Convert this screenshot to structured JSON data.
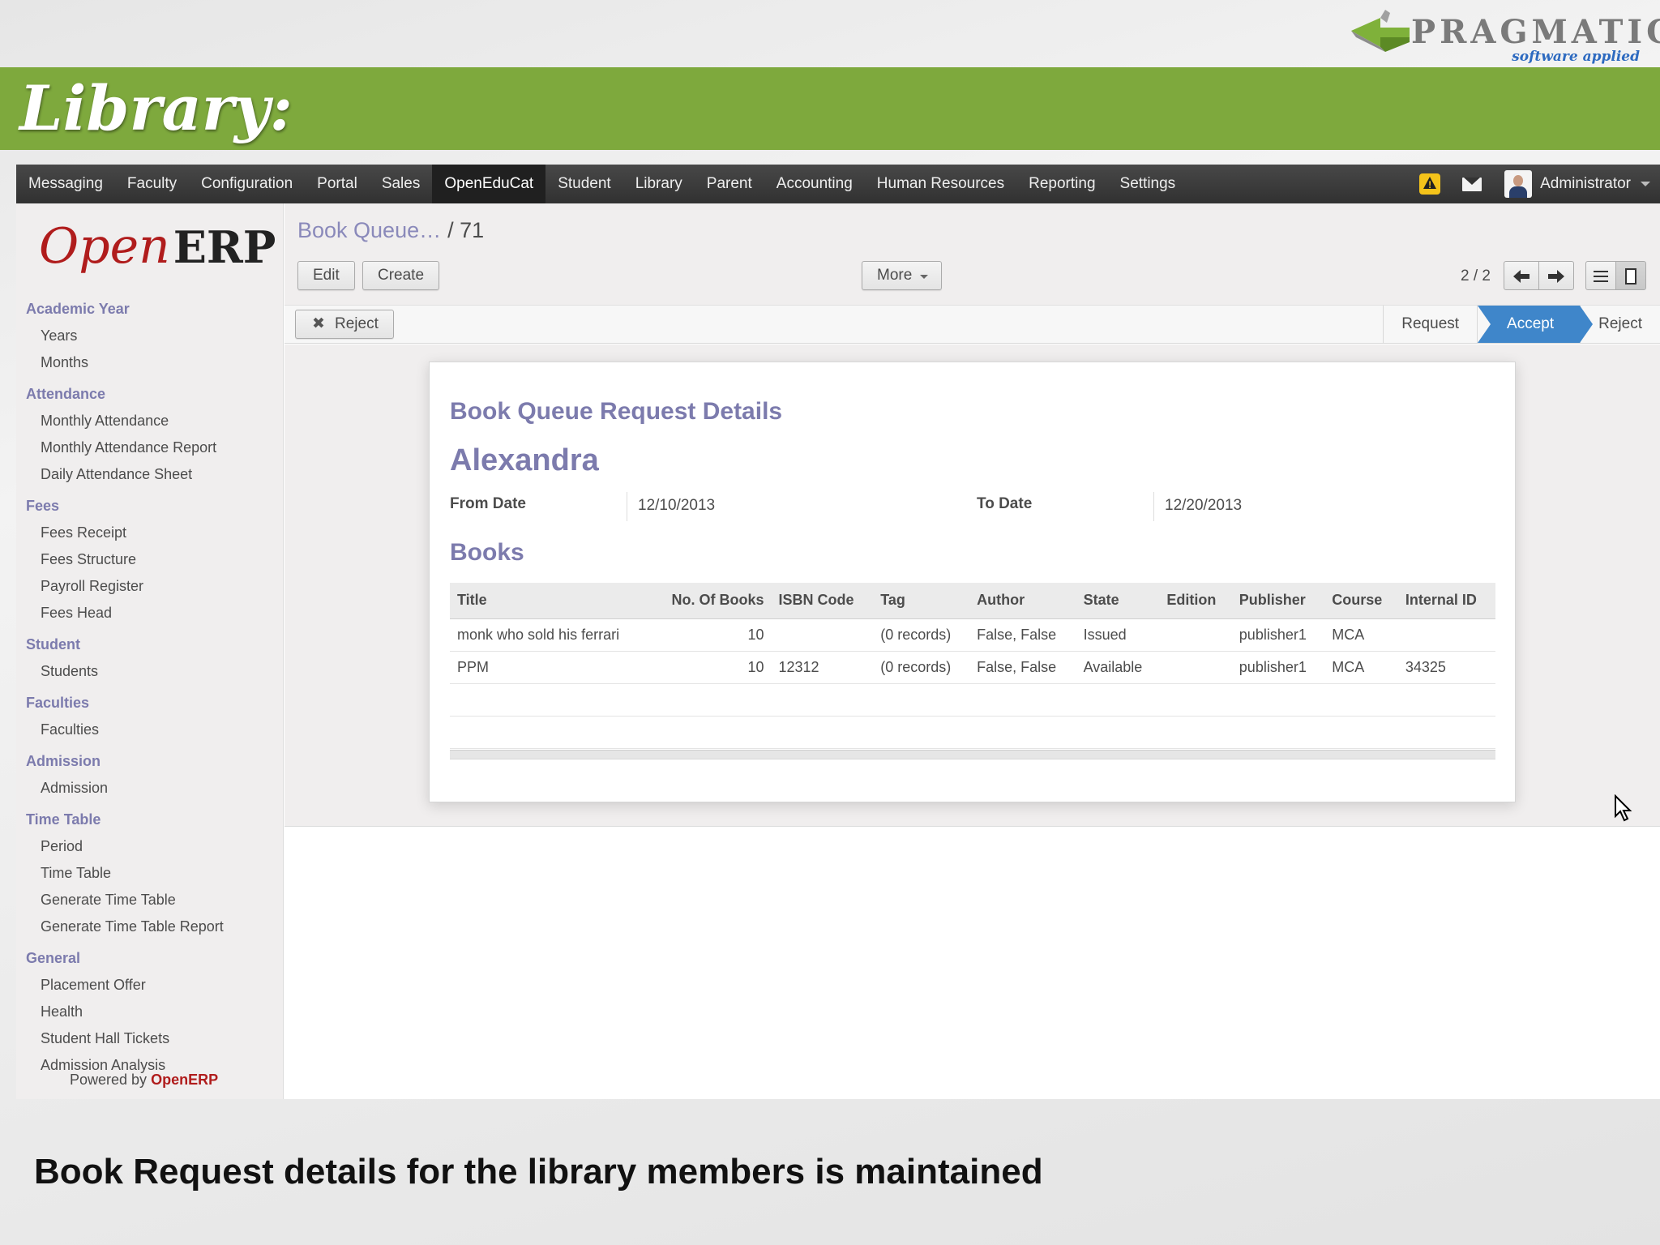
{
  "brand": {
    "word": "PRAGMATIC",
    "tagline": "software applied"
  },
  "slide": {
    "title": "Library:",
    "caption": "Book Request details for the library members is maintained"
  },
  "topbar": {
    "menu": [
      "Messaging",
      "Faculty",
      "Configuration",
      "Portal",
      "Sales",
      "OpenEduCat",
      "Student",
      "Library",
      "Parent",
      "Accounting",
      "Human Resources",
      "Reporting",
      "Settings"
    ],
    "active": "OpenEduCat",
    "user": "Administrator"
  },
  "sidebar": {
    "logo_open": "Open",
    "logo_erp": "ERP",
    "sections": [
      {
        "title": "Academic Year",
        "items": [
          "Years",
          "Months"
        ]
      },
      {
        "title": "Attendance",
        "items": [
          "Monthly Attendance",
          "Monthly Attendance Report",
          "Daily Attendance Sheet"
        ]
      },
      {
        "title": "Fees",
        "items": [
          "Fees Receipt",
          "Fees Structure",
          "Payroll Register",
          "Fees Head"
        ]
      },
      {
        "title": "Student",
        "items": [
          "Students"
        ]
      },
      {
        "title": "Faculties",
        "items": [
          "Faculties"
        ]
      },
      {
        "title": "Admission",
        "items": [
          "Admission"
        ]
      },
      {
        "title": "Time Table",
        "items": [
          "Period",
          "Time Table",
          "Generate Time Table",
          "Generate Time Table Report"
        ]
      },
      {
        "title": "General",
        "items": [
          "Placement Offer",
          "Health",
          "Student Hall Tickets",
          "Admission Analysis"
        ]
      }
    ],
    "powered_prefix": "Powered by",
    "powered_brand": "OpenERP"
  },
  "header": {
    "breadcrumb_parent": "Book Queue…",
    "breadcrumb_current": "/ 71",
    "edit_label": "Edit",
    "create_label": "Create",
    "more_label": "More",
    "pager": "2 / 2"
  },
  "statusbar": {
    "reject_label": "Reject",
    "stages": [
      "Request",
      "Accept",
      "Reject"
    ],
    "current_stage": "Accept"
  },
  "form": {
    "title": "Book Queue Request Details",
    "student": "Alexandra",
    "from_label": "From Date",
    "from_value": "12/10/2013",
    "to_label": "To Date",
    "to_value": "12/20/2013",
    "books_title": "Books",
    "columns": [
      "Title",
      "No. Of Books",
      "ISBN Code",
      "Tag",
      "Author",
      "State",
      "Edition",
      "Publisher",
      "Course",
      "Internal ID"
    ],
    "rows": [
      [
        "monk who sold his ferrari",
        "10",
        "",
        "(0 records)",
        "False, False",
        "Issued",
        "",
        "publisher1",
        "MCA",
        ""
      ],
      [
        "PPM",
        "10",
        "12312",
        "(0 records)",
        "False, False",
        "Available",
        "",
        "publisher1",
        "MCA",
        "34325"
      ]
    ]
  },
  "icons": {
    "warning": "warning-icon",
    "mail": "mail-icon",
    "prev": "arrow-left-icon",
    "next": "arrow-right-icon",
    "list": "list-view-icon",
    "form": "form-view-icon",
    "reject": "close-icon",
    "cursor": "mouse-pointer-icon"
  },
  "colors": {
    "brand_green": "#7ea93d",
    "accent_purple": "#7c7bad",
    "active_stage": "#3f86ca",
    "openerp_red": "#b01c1c"
  }
}
